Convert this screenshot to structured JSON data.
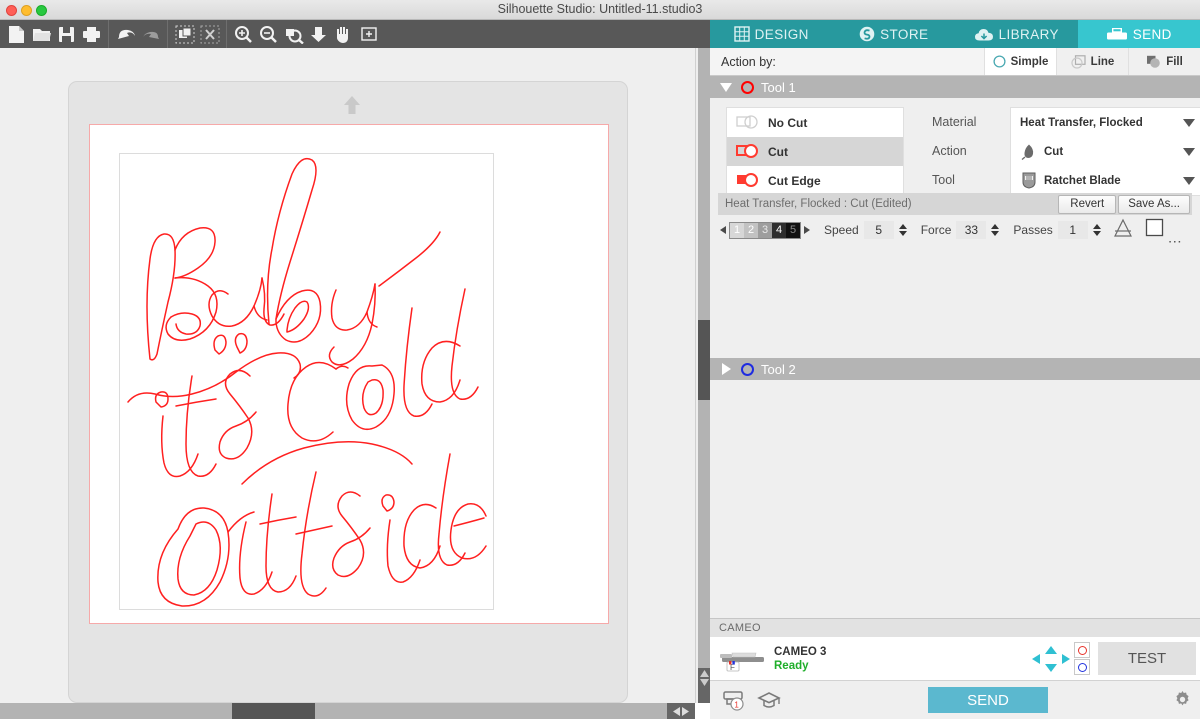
{
  "window": {
    "title": "Silhouette Studio: Untitled-11.studio3",
    "traffic_lights": [
      "close",
      "minimize",
      "maximize"
    ]
  },
  "toolbar": {
    "groups": [
      {
        "buttons": [
          {
            "name": "new-document-icon",
            "label": "New"
          },
          {
            "name": "open-folder-icon",
            "label": "Open"
          },
          {
            "name": "save-icon",
            "label": "Save"
          },
          {
            "name": "print-icon",
            "label": "Print"
          }
        ]
      },
      {
        "buttons": [
          {
            "name": "undo-icon",
            "label": "Undo"
          },
          {
            "name": "redo-icon",
            "label": "Redo"
          }
        ]
      },
      {
        "buttons": [
          {
            "name": "group-icon",
            "label": "Group"
          },
          {
            "name": "ungroup-icon",
            "label": "Ungroup"
          }
        ]
      },
      {
        "buttons": [
          {
            "name": "zoom-in-icon",
            "label": "Zoom In"
          },
          {
            "name": "zoom-out-icon",
            "label": "Zoom Out"
          },
          {
            "name": "zoom-selection-icon",
            "label": "Zoom to Selection"
          },
          {
            "name": "fit-to-page-icon",
            "label": "Fit to Page"
          },
          {
            "name": "pan-hand-icon",
            "label": "Pan"
          },
          {
            "name": "fit-window-icon",
            "label": "Fit to Window"
          }
        ]
      }
    ]
  },
  "canvas": {
    "design_text": "Baby it's cold Outside",
    "cut_line_color": "#ff2020",
    "cut_border_color": "#f6a9a9",
    "mat_color": "#e4e4e4",
    "page_color": "#ffffff",
    "feed_arrow": "mat-feed-arrow-icon"
  },
  "tabs": [
    {
      "label": "DESIGN",
      "icon": "grid-icon",
      "active": false
    },
    {
      "label": "STORE",
      "icon": "store-icon",
      "active": false
    },
    {
      "label": "LIBRARY",
      "icon": "cloud-download-icon",
      "active": false
    },
    {
      "label": "SEND",
      "icon": "cutter-icon",
      "active": true
    }
  ],
  "action_by": {
    "label": "Action by:",
    "modes": [
      {
        "label": "Simple",
        "icon": "circle-outline-icon",
        "active": true
      },
      {
        "label": "Line",
        "icon": "overlapping-squares-icon",
        "active": false
      },
      {
        "label": "Fill",
        "icon": "filled-shapes-icon",
        "active": false
      }
    ]
  },
  "tool1": {
    "header_label": "Tool 1",
    "ring_color": "#ff0000",
    "expanded": true,
    "cut_modes": [
      {
        "label": "No Cut",
        "icon": "no-cut-icon",
        "selected": false
      },
      {
        "label": "Cut",
        "icon": "cut-icon",
        "selected": true
      },
      {
        "label": "Cut Edge",
        "icon": "cut-edge-icon",
        "selected": false
      }
    ],
    "fields": [
      {
        "label": "Material",
        "value": "Heat Transfer, Flocked",
        "icon": null
      },
      {
        "label": "Action",
        "value": "Cut",
        "icon": "blade-icon"
      },
      {
        "label": "Tool",
        "value": "Ratchet Blade",
        "icon": "ratchet-blade-icon"
      }
    ],
    "preset": {
      "name": "Heat Transfer, Flocked : Cut (Edited)",
      "revert_label": "Revert",
      "save_as_label": "Save As..."
    },
    "settings": {
      "blade_depth_options": [
        "1",
        "2",
        "3",
        "4",
        "5"
      ],
      "blade_depth_selected": "4",
      "speed_label": "Speed",
      "speed_value": "5",
      "force_label": "Force",
      "force_value": "33",
      "passes_label": "Passes",
      "passes_value": "1",
      "extra_icons": [
        "overcut-icon",
        "square-icon",
        "more-options-icon"
      ]
    }
  },
  "tool2": {
    "header_label": "Tool 2",
    "ring_color": "#1f2ce0",
    "expanded": false
  },
  "device": {
    "section_label": "CAMEO",
    "name": "CAMEO 3",
    "status": "Ready",
    "status_color": "#1fae2a",
    "thumb_icon": "cameo-machine-icon",
    "dpad_icon": "dpad-arrows-icon",
    "led_left": "tool1-led-red",
    "led_right": "tool2-led-blue",
    "test_label": "TEST"
  },
  "bottom": {
    "queue_icon": "print-queue-icon",
    "queue_badge": "1",
    "tutorial_icon": "graduation-cap-icon",
    "send_label": "SEND",
    "send_color": "#5bb8cf",
    "settings_icon": "gear-icon"
  },
  "scrollbars": {
    "vertical_position": "44%",
    "horizontal_position": "33%"
  }
}
